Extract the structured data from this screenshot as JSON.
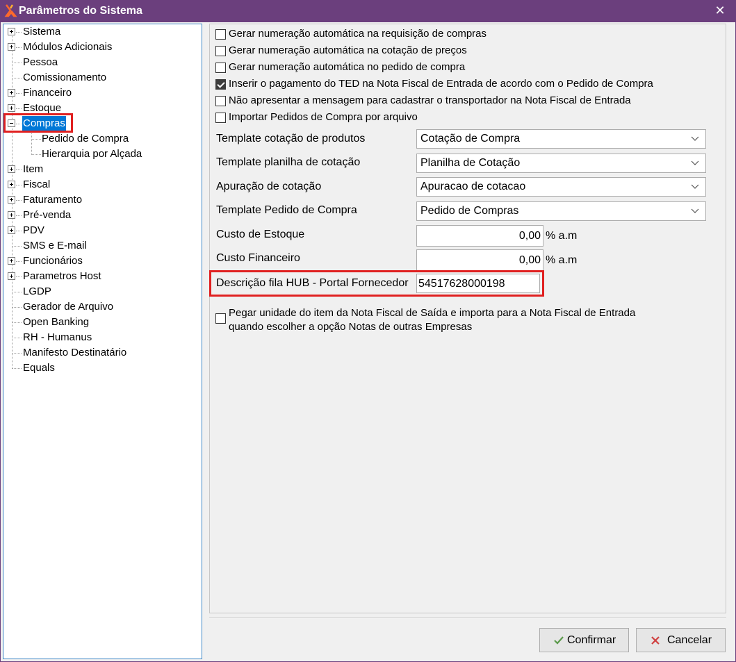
{
  "window": {
    "title": "Parâmetros do Sistema",
    "close_glyph": "✕"
  },
  "tree": {
    "items": [
      {
        "label": "Sistema",
        "expander": "plus"
      },
      {
        "label": "Módulos Adicionais",
        "expander": "plus"
      },
      {
        "label": "Pessoa",
        "expander": "none"
      },
      {
        "label": "Comissionamento",
        "expander": "none"
      },
      {
        "label": "Financeiro",
        "expander": "plus"
      },
      {
        "label": "Estoque",
        "expander": "plus"
      },
      {
        "label": "Compras",
        "expander": "minus",
        "selected": true
      },
      {
        "label": "Pedido de Compra",
        "expander": "child"
      },
      {
        "label": "Hierarquia por Alçada",
        "expander": "child"
      },
      {
        "label": "Item",
        "expander": "plus"
      },
      {
        "label": "Fiscal",
        "expander": "plus"
      },
      {
        "label": "Faturamento",
        "expander": "plus"
      },
      {
        "label": "Pré-venda",
        "expander": "plus"
      },
      {
        "label": "PDV",
        "expander": "plus"
      },
      {
        "label": "SMS e E-mail",
        "expander": "none"
      },
      {
        "label": "Funcionários",
        "expander": "plus"
      },
      {
        "label": "Parametros Host",
        "expander": "plus"
      },
      {
        "label": "LGDP",
        "expander": "none"
      },
      {
        "label": "Gerador de Arquivo",
        "expander": "none"
      },
      {
        "label": "Open Banking",
        "expander": "none"
      },
      {
        "label": "RH - Humanus",
        "expander": "none"
      },
      {
        "label": "Manifesto Destinatário",
        "expander": "none"
      },
      {
        "label": "Equals",
        "expander": "none"
      }
    ]
  },
  "checkboxes": [
    {
      "label": "Gerar numeração automática na requisição de compras",
      "checked": false
    },
    {
      "label": "Gerar numeração automática na cotação de preços",
      "checked": false
    },
    {
      "label": "Gerar numeração automática no pedido de compra",
      "checked": false
    },
    {
      "label": "Inserir o pagamento do TED na Nota Fiscal de Entrada de acordo com o Pedido de Compra",
      "checked": true
    },
    {
      "label": "Não apresentar a mensagem para cadastrar o transportador na Nota Fiscal de Entrada",
      "checked": false
    },
    {
      "label": "Importar Pedidos de Compra por arquivo",
      "checked": false
    }
  ],
  "form": {
    "template_cotacao": {
      "label": "Template cotação de produtos",
      "value": "Cotação  de Compra"
    },
    "template_planilha": {
      "label": "Template planilha de cotação",
      "value": "Planilha de Cotação"
    },
    "apuracao": {
      "label": "Apuração de cotação",
      "value": "Apuracao de cotacao"
    },
    "template_pedido": {
      "label": "Template Pedido de Compra",
      "value": "Pedido de Compras"
    },
    "custo_estoque": {
      "label": "Custo de Estoque",
      "value": "0,00",
      "unit": "% a.m"
    },
    "custo_financeiro": {
      "label": "Custo Financeiro",
      "value": "0,00",
      "unit": "% a.m"
    },
    "fila_hub": {
      "label": "Descrição fila HUB - Portal Fornecedor",
      "value": "54517628000198"
    }
  },
  "bottom_checkbox": {
    "line1": "Pegar unidade do item da Nota Fiscal de Saída e importa para a Nota Fiscal de Entrada",
    "line2": "quando escolher a opção Notas de outras Empresas",
    "checked": false
  },
  "buttons": {
    "confirm": "Confirmar",
    "cancel": "Cancelar"
  },
  "colors": {
    "titlebar": "#6b3f7d",
    "selection": "#0078d7",
    "highlight_box": "#e02020",
    "confirm_icon": "#5a9a4a",
    "cancel_icon": "#d04040"
  }
}
